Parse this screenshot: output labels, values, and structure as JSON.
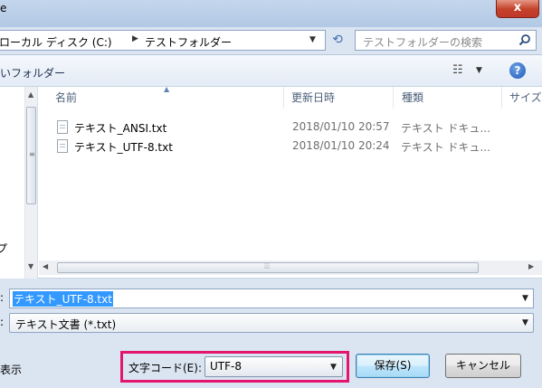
{
  "window": {
    "title_fragment": "e",
    "close_label": "x"
  },
  "address": {
    "segments": [
      "ローカル ディスク (C:)",
      "テストフォルダー"
    ],
    "search_placeholder": "テストフォルダーの検索"
  },
  "toolbar": {
    "new_folder": "いフォルダー",
    "help_label": "?"
  },
  "columns": [
    "名前",
    "更新日時",
    "種類",
    "サイズ"
  ],
  "files": [
    {
      "name": "テキスト_ANSI.txt",
      "date": "2018/01/10 20:57",
      "type": "テキスト ドキュ..."
    },
    {
      "name": "テキスト_UTF-8.txt",
      "date": "2018/01/10 20:24",
      "type": "テキスト ドキュ..."
    }
  ],
  "nav": {
    "partial_item": "プ"
  },
  "form": {
    "filename_label": ":",
    "filename_value": "テキスト_UTF-8.txt",
    "filetype_label": ":",
    "filetype_value": "テキスト文書 (*.txt)",
    "hide_folders": "表示",
    "encoding_label": "文字コード(E):",
    "encoding_value": "UTF-8",
    "save_label": "保存(S)",
    "cancel_label": "キャンセル"
  },
  "colors": {
    "highlight": "#e5156f",
    "selection": "#3399ff"
  }
}
